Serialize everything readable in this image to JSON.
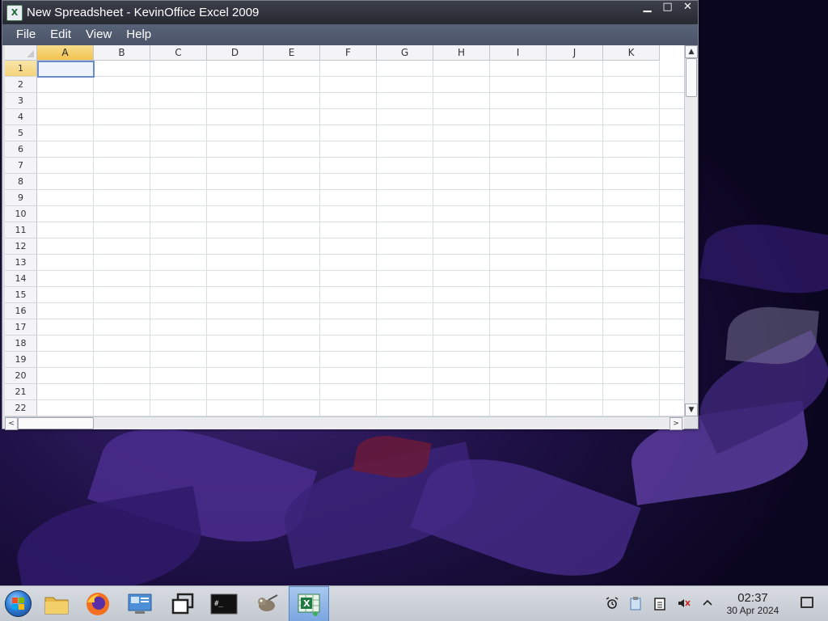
{
  "window": {
    "title": "New Spreadsheet - KevinOffice Excel 2009",
    "app_icon_glyph": "X",
    "buttons": {
      "minimize": "▁",
      "maximize": "□",
      "close": "✕"
    }
  },
  "menu": {
    "items": [
      "File",
      "Edit",
      "View",
      "Help"
    ]
  },
  "spreadsheet": {
    "columns": [
      "A",
      "B",
      "C",
      "D",
      "E",
      "F",
      "G",
      "H",
      "I",
      "J",
      "K"
    ],
    "rows": [
      "1",
      "2",
      "3",
      "4",
      "5",
      "6",
      "7",
      "8",
      "9",
      "10",
      "11",
      "12",
      "13",
      "14",
      "15",
      "16",
      "17",
      "18",
      "19",
      "20",
      "21",
      "22"
    ],
    "active_cell": "A1"
  },
  "scrollbars": {
    "up_arrow": "▲",
    "down_arrow": "▼",
    "left_arrow": "<",
    "right_arrow": ">"
  },
  "taskbar": {
    "apps": [
      "file-manager-icon",
      "firefox-icon",
      "system-settings-icon",
      "window-switcher-icon",
      "terminal-icon",
      "gimp-icon",
      "spreadsheet-app-icon"
    ],
    "active_app": "spreadsheet-app-icon",
    "tray_icons": [
      "alarm-icon",
      "clipboard-paste-icon",
      "clipboard-icon",
      "volume-muted-icon",
      "chevron-up-icon"
    ],
    "clock": {
      "time": "02:37",
      "date": "30 Apr 2024"
    }
  },
  "colors": {
    "accent": "#f1c24e",
    "titlebar": "#2e3139",
    "menubar": "#525c70",
    "active_taskbar": "#7aa6e0"
  }
}
